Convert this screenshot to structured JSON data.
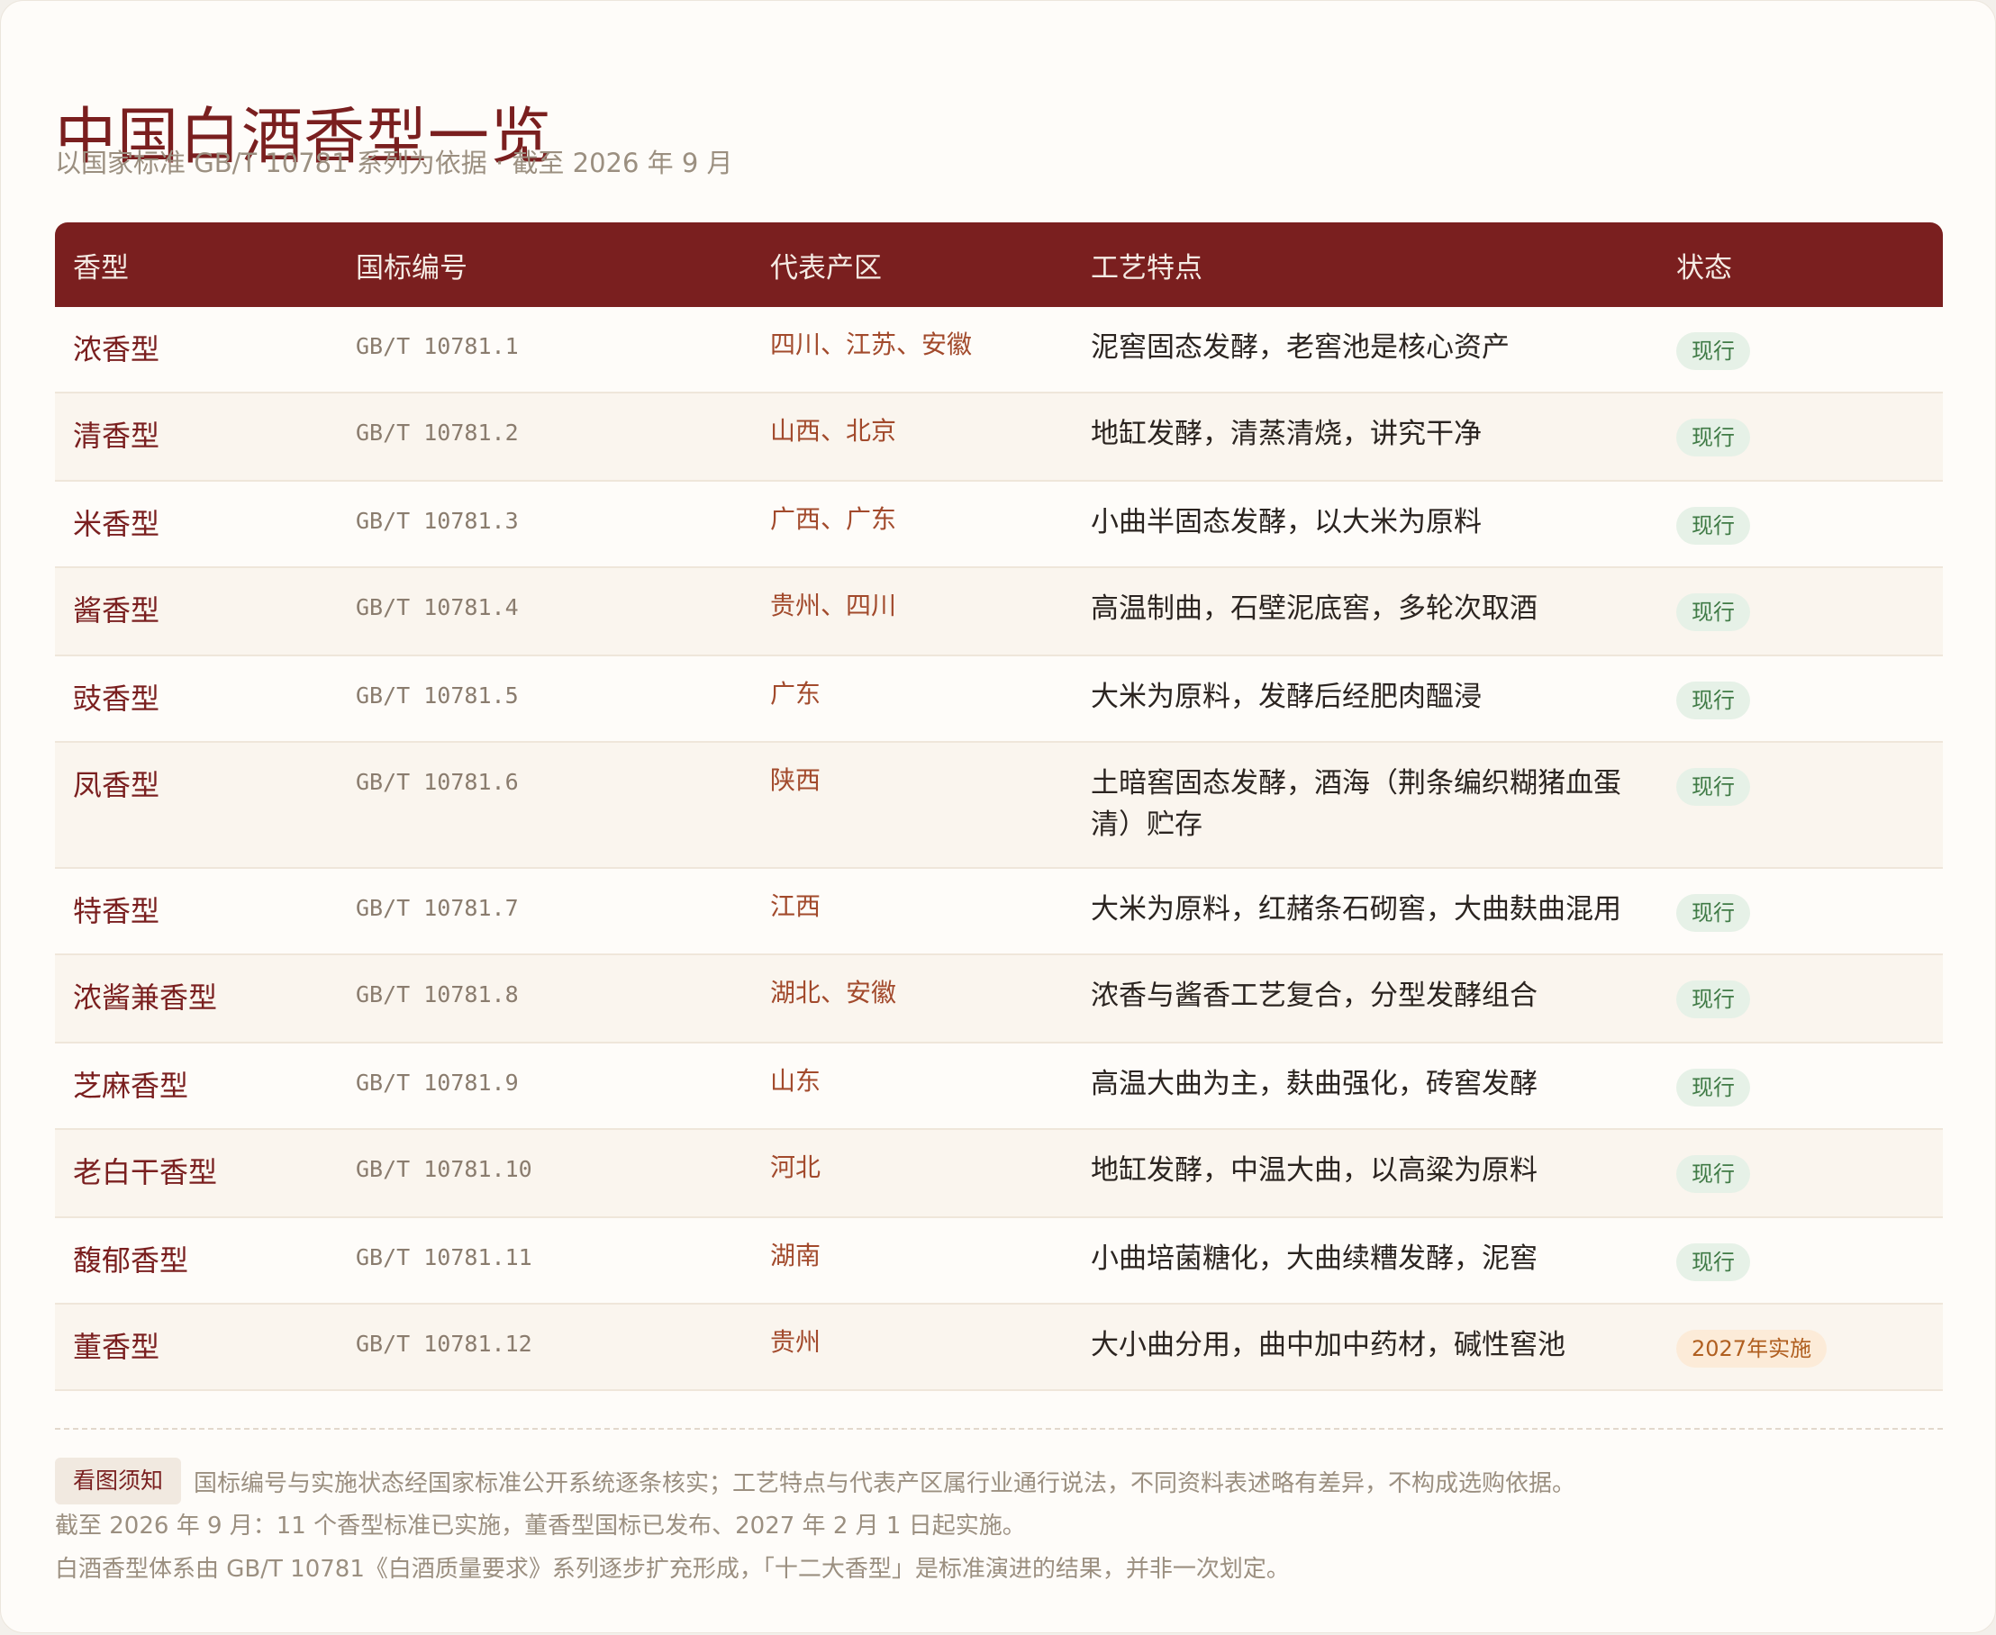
{
  "page": {
    "title": "中国白酒香型一览",
    "subtitle": "以国家标准 GB/T 10781 系列为依据 · 截至 2026 年 9 月"
  },
  "table": {
    "headers": [
      "香型",
      "国标编号",
      "代表产区",
      "工艺特点",
      "状态"
    ],
    "rows": [
      {
        "name": "浓香型",
        "code": "GB/T 10781.1",
        "region": "四川、江苏、安徽",
        "craft": "泥窖固态发酵，老窖池是核心资产",
        "status": "现行"
      },
      {
        "name": "清香型",
        "code": "GB/T 10781.2",
        "region": "山西、北京",
        "craft": "地缸发酵，清蒸清烧，讲究干净",
        "status": "现行"
      },
      {
        "name": "米香型",
        "code": "GB/T 10781.3",
        "region": "广西、广东",
        "craft": "小曲半固态发酵，以大米为原料",
        "status": "现行"
      },
      {
        "name": "酱香型",
        "code": "GB/T 10781.4",
        "region": "贵州、四川",
        "craft": "高温制曲，石壁泥底窖，多轮次取酒",
        "status": "现行"
      },
      {
        "name": "豉香型",
        "code": "GB/T 10781.5",
        "region": "广东",
        "craft": "大米为原料，发酵后经肥肉醞浸",
        "status": "现行"
      },
      {
        "name": "凤香型",
        "code": "GB/T 10781.6",
        "region": "陕西",
        "craft": "土暗窖固态发酵，酒海（荆条编织糊猪血蛋清）贮存",
        "status": "现行"
      },
      {
        "name": "特香型",
        "code": "GB/T 10781.7",
        "region": "江西",
        "craft": "大米为原料，红赭条石砌窖，大曲麸曲混用",
        "status": "现行"
      },
      {
        "name": "浓酱兼香型",
        "code": "GB/T 10781.8",
        "region": "湖北、安徽",
        "craft": "浓香与酱香工艺复合，分型发酵组合",
        "status": "现行"
      },
      {
        "name": "芝麻香型",
        "code": "GB/T 10781.9",
        "region": "山东",
        "craft": "高温大曲为主，麸曲强化，砖窖发酵",
        "status": "现行"
      },
      {
        "name": "老白干香型",
        "code": "GB/T 10781.10",
        "region": "河北",
        "craft": "地缸发酵，中温大曲，以高粱为原料",
        "status": "现行"
      },
      {
        "name": "馥郁香型",
        "code": "GB/T 10781.11",
        "region": "湖南",
        "craft": "小曲培菌糖化，大曲续糟发酵，泥窖",
        "status": "现行"
      },
      {
        "name": "董香型",
        "code": "GB/T 10781.12",
        "region": "贵州",
        "craft": "大小曲分用，曲中加中药材，碱性窖池",
        "status": "2027年实施"
      }
    ]
  },
  "notes": {
    "tag": "看图须知",
    "line1": "国标编号与实施状态经国家标准公开系统逐条核实；工艺特点与代表产区属行业通行说法，不同资料表述略有差异，不构成选购依据。",
    "line2": "截至 2026 年 9 月：11 个香型标准已实施，董香型国标已发布、2027 年 2 月 1 日起实施。",
    "line3": "白酒香型体系由 GB/T 10781《白酒质量要求》系列逐步扩充形成，「十二大香型」是标准演进的结果，并非一次划定。"
  },
  "colors": {
    "brand": "#7a1f1f",
    "status_current_bg": "#e6f1e7",
    "status_current_text": "#3f7a45",
    "status_upcoming_bg": "#fcebd8",
    "status_upcoming_text": "#b05f20"
  }
}
